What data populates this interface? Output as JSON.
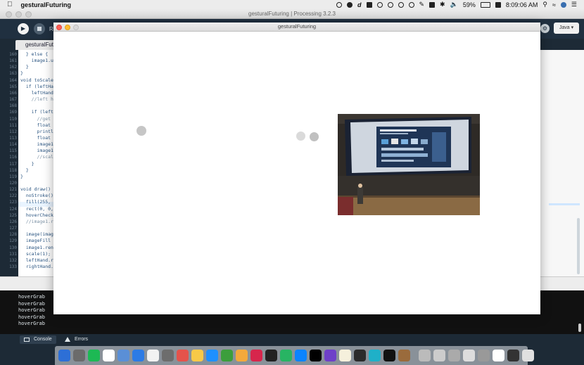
{
  "menubar": {
    "app_name": "gesturalFuturing",
    "battery": "59%",
    "clock": "8:09:06 AM"
  },
  "ide": {
    "window_title": "gesturalFuturing | Processing 3.2.3",
    "tab_label": "gesturalFuturing",
    "toolbar_r": "R",
    "mode": "Java ▾",
    "line_numbers": [
      "160",
      "161",
      "162",
      "163",
      "164",
      "165",
      "166",
      "167",
      "168",
      "169",
      "110",
      "111",
      "112",
      "113",
      "114",
      "115",
      "116",
      "117",
      "118",
      "119",
      "120",
      "121",
      "122",
      "123",
      "124",
      "125",
      "126",
      "127",
      "128",
      "129",
      "130",
      "131",
      "132",
      "133"
    ],
    "code_lines": [
      "  } else {",
      "    image1.u",
      "  }",
      "}",
      "void toScale",
      "  if (leftHa",
      "    leftHand",
      "    //left h",
      "",
      "    if (left",
      "      //get",
      "      float",
      "      printl",
      "      float",
      "      image1",
      "      image1",
      "      //scal",
      "    }",
      "  }",
      "}",
      "",
      "void draw()",
      "  noStroke()",
      "  fill(255,",
      "  rect(0, 0,",
      "  hoverCheck",
      "  //image1.r",
      "",
      "  image(imag",
      "  imageFill",
      "  image1.ren",
      "  scale(1);",
      "  leftHand.r",
      "  rightHand."
    ]
  },
  "console": {
    "lines": [
      "hoverGrab",
      "hoverGrab",
      "hoverGrab",
      "hoverGrab",
      "hoverGrab"
    ],
    "tabs": {
      "console": "Console",
      "errors": "Errors"
    }
  },
  "sketch": {
    "window_title": "gesturalFuturing"
  }
}
